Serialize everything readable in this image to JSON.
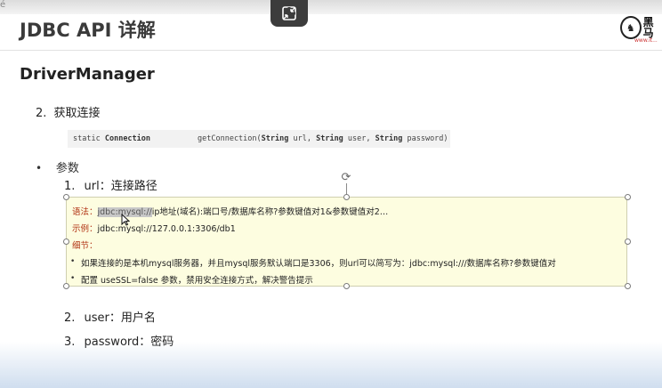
{
  "corner_mark": "é",
  "slide": {
    "title": "JDBC API 详解",
    "logo_text": "黑马",
    "logo_sub": "www.it...",
    "section_heading": "DriverManager"
  },
  "content": {
    "item2_number": "2.",
    "item2_text": "获取连接",
    "code_static": "static",
    "code_type": "Connection",
    "code_method": "getConnection(",
    "code_param1_type": "String",
    "code_param1_name": " url, ",
    "code_param2_type": "String",
    "code_param2_name": " user, ",
    "code_param3_type": "String",
    "code_param3_name": " password)",
    "bullet_symbol": "•",
    "params_label": "参数",
    "sub1_number": "1.",
    "sub1_text": "url：连接路径",
    "sub2_number": "2.",
    "sub2_text": "user：用户名",
    "sub3_number": "3.",
    "sub3_text": "password：密码"
  },
  "note": {
    "syntax_label": "语法：",
    "syntax_highlight": "jdbc:mysql://",
    "syntax_rest": "ip地址(域名):端口号/数据库名称?参数键值对1&参数键值对2…",
    "example_label": "示例：",
    "example_text": "jdbc:mysql://127.0.0.1:3306/db1",
    "detail_label": "细节：",
    "detail_1": "如果连接的是本机mysql服务器，并且mysql服务默认端口是3306，则url可以简写为：jdbc:mysql:///数据库名称?参数键值对",
    "detail_2": "配置 useSSL=false 参数，禁用安全连接方式，解决警告提示"
  },
  "icons": {
    "overlay": "exit-fullscreen-icon",
    "rotate": "rotate-handle-icon",
    "cursor": "mouse-pointer-icon"
  }
}
